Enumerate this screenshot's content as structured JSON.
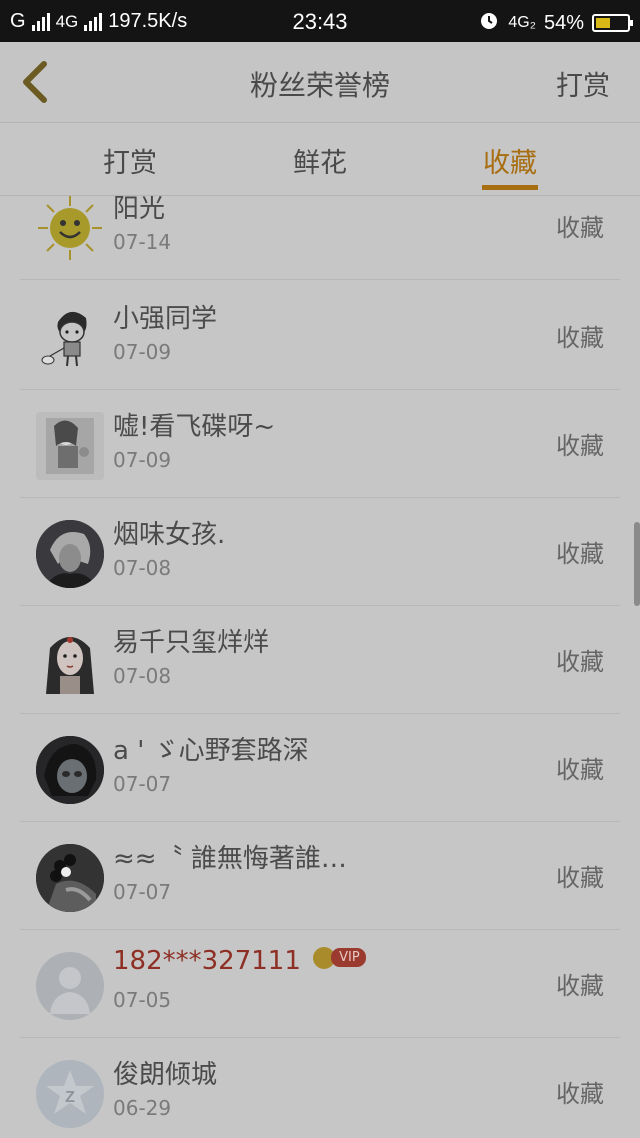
{
  "status_bar": {
    "carrier": "G",
    "network": "4G",
    "speed": "197.5K/s",
    "time": "23:43",
    "network2": "4G₂",
    "battery": "54%",
    "battery_level": 0.54
  },
  "header": {
    "title": "粉丝荣誉榜",
    "right_action": "打赏"
  },
  "tabs": [
    {
      "label": "打赏",
      "active": false
    },
    {
      "label": "鲜花",
      "active": false
    },
    {
      "label": "收藏",
      "active": true
    }
  ],
  "fans": [
    {
      "name": "阳光",
      "date": "07-14",
      "action": "收藏",
      "avatar": "sun-avatar"
    },
    {
      "name": "小强同学",
      "date": "07-09",
      "action": "收藏",
      "avatar": "cartoon-boy-avatar"
    },
    {
      "name": "嘘!看飞碟呀~",
      "date": "07-09",
      "action": "收藏",
      "avatar": "illustration-avatar"
    },
    {
      "name": "烟味女孩.",
      "date": "07-08",
      "action": "收藏",
      "avatar": "photo-avatar"
    },
    {
      "name": "易千只玺烊烊",
      "date": "07-08",
      "action": "收藏",
      "avatar": "anime-girl-avatar"
    },
    {
      "name": "a ' ゞ心野套路深",
      "date": "07-07",
      "action": "收藏",
      "avatar": "photo-avatar"
    },
    {
      "name": "≈≈〝 誰無悔著誰…",
      "date": "07-07",
      "action": "收藏",
      "avatar": "photo-avatar"
    },
    {
      "name": "182***327111",
      "date": "07-05",
      "action": "收藏",
      "avatar": "default-avatar",
      "vip": "VIP"
    },
    {
      "name": "俊朗倾城",
      "date": "06-29",
      "action": "收藏",
      "avatar": "qq-avatar"
    }
  ]
}
